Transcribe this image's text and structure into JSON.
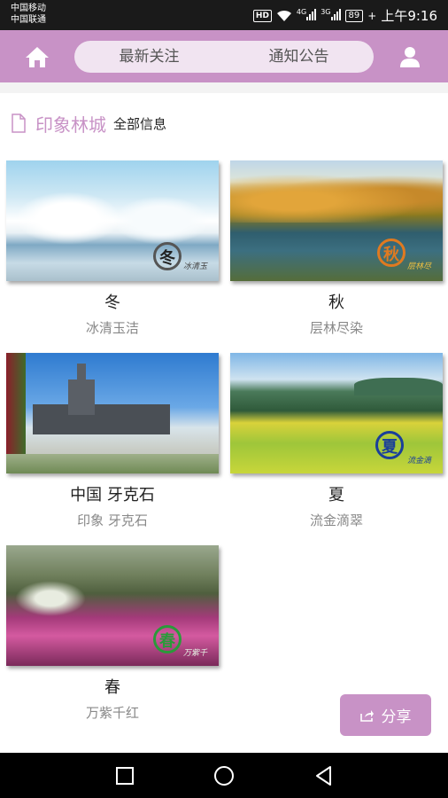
{
  "status_bar": {
    "carrier_1": "中国移动",
    "carrier_2": "中国联通",
    "hd": "HD",
    "net_1": "4G",
    "net_2": "3G",
    "battery": "89",
    "time": "上午9:16"
  },
  "header": {
    "tabs": [
      {
        "label": "最新关注"
      },
      {
        "label": "通知公告"
      }
    ]
  },
  "section": {
    "title": "印象林城",
    "subtitle": "全部信息"
  },
  "cards": [
    {
      "title": "冬",
      "subtitle": "冰清玉洁",
      "seal": "冬",
      "tag": "冰清玉"
    },
    {
      "title": "秋",
      "subtitle": "层林尽染",
      "seal": "秋",
      "tag": "层林尽"
    },
    {
      "title": "中国 牙克石",
      "subtitle": "印象 牙克石"
    },
    {
      "title": "夏",
      "subtitle": "流金滴翠",
      "seal": "夏",
      "tag": "流金滴"
    },
    {
      "title": "春",
      "subtitle": "万紫千红",
      "seal": "春",
      "tag": "万紫千"
    }
  ],
  "share": {
    "label": "分享"
  },
  "colors": {
    "accent": "#c892c6",
    "tab_bg": "#f1e4f1"
  }
}
